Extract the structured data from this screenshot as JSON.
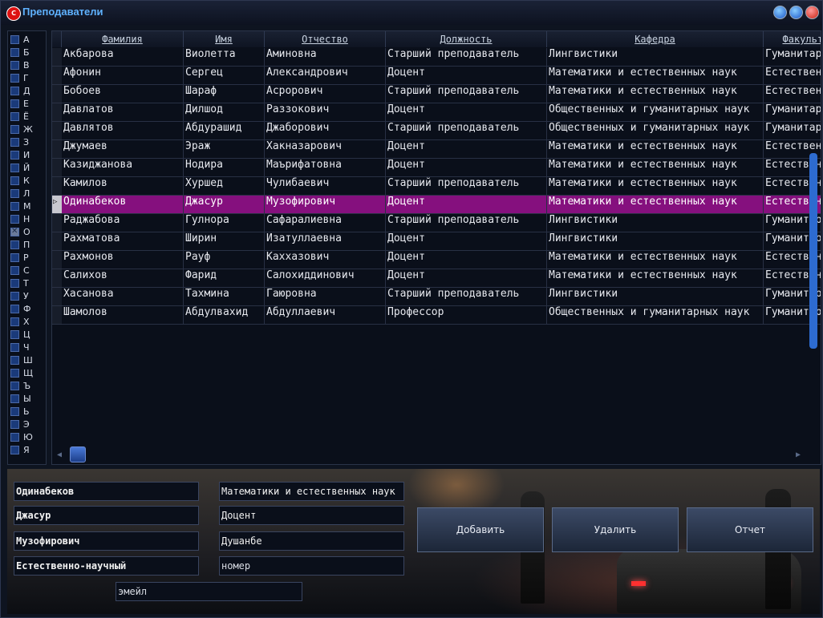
{
  "window": {
    "title": "Преподаватели",
    "icon_letter": "C"
  },
  "alphabet": {
    "letters": [
      "А",
      "Б",
      "В",
      "Г",
      "Д",
      "Е",
      "Ё",
      "Ж",
      "З",
      "И",
      "Й",
      "К",
      "Л",
      "М",
      "Н",
      "О",
      "П",
      "Р",
      "С",
      "Т",
      "У",
      "Ф",
      "Х",
      "Ц",
      "Ч",
      "Ш",
      "Щ",
      "Ъ",
      "Ы",
      "Ь",
      "Э",
      "Ю",
      "Я"
    ],
    "checked": "О"
  },
  "table": {
    "columns": [
      "Фамилия",
      "Имя",
      "Отчество",
      "Должность",
      "Кафедра",
      "Факультет"
    ],
    "selected_row": 8,
    "rows": [
      [
        "Акбарова",
        "Виолетта",
        "Аминовна",
        "Старший преподаватель",
        "Лингвистики",
        "Гуманитарный"
      ],
      [
        "Афонин",
        "Сергец",
        "Александрович",
        "Доцент",
        "Математики и естественных наук",
        "Естественно-научный"
      ],
      [
        "Бобоев",
        "Шараф",
        "Асрорович",
        "Старший преподаватель",
        "Математики и естественных наук",
        "Естественно-научный"
      ],
      [
        "Давлатов",
        "Дилшод",
        "Раззокович",
        "Доцент",
        "Общественных и гуманитарных наук",
        "Гуманитарный"
      ],
      [
        "Давлятов",
        "Абдурашид",
        "Джаборович",
        "Старший преподаватель",
        "Общественных и гуманитарных наук",
        "Гуманитарный"
      ],
      [
        "Джумаев",
        "Эраж",
        "Хакназарович",
        "Доцент",
        "Математики и естественных наук",
        "Естественно-научный"
      ],
      [
        "Казиджанова",
        "Нодира",
        "Маърифатовна",
        "Доцент",
        "Математики и естественных наук",
        "Естественно-научный"
      ],
      [
        "Камилов",
        "Хуршед",
        "Чулибаевич",
        "Старший преподаватель",
        "Математики и естественных наук",
        "Естественно-научный"
      ],
      [
        "Одинабеков",
        "Джасур",
        "Музофирович",
        "Доцент",
        "Математики и естественных наук",
        "Естественно-научный"
      ],
      [
        "Раджабова",
        "Гулнора",
        "Сафаралиевна",
        "Старший преподаватель",
        "Лингвистики",
        "Гуманитарный"
      ],
      [
        "Рахматова",
        "Ширин",
        "Изатуллаевна",
        "Доцент",
        "Лингвистики",
        "Гуманитарный"
      ],
      [
        "Рахмонов",
        "Рауф",
        "Каххазович",
        "Доцент",
        "Математики и естественных наук",
        "Естественно-научный"
      ],
      [
        "Салихов",
        "Фарид",
        "Салохиддинович",
        "Доцент",
        "Математики и естественных наук",
        "Естественно-научный"
      ],
      [
        "Хасанова",
        "Тахмина",
        "Гаюровна",
        "Старший преподаватель",
        "Лингвистики",
        "Гуманитарный"
      ],
      [
        "Шамолов",
        "Абдулвахид",
        "Абдуллаевич",
        "Профессор",
        "Общественных и гуманитарных наук",
        "Гуманитарный"
      ]
    ]
  },
  "form": {
    "last_name": "Одинабеков",
    "first_name": "Джасур",
    "patronymic": "Музофирович",
    "faculty": "Естественно-научный",
    "department": "Математики и естественных наук",
    "position": "Доцент",
    "city": "Душанбе",
    "phone": "номер",
    "email": "эмейл"
  },
  "buttons": {
    "add": "Добавить",
    "delete": "Удалить",
    "report": "Отчет"
  }
}
